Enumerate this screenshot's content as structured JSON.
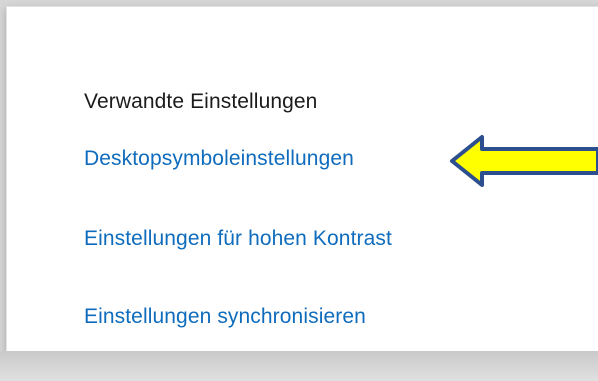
{
  "related_settings": {
    "title": "Verwandte Einstellungen",
    "links": [
      "Desktopsymboleinstellungen",
      "Einstellungen für hohen Kontrast",
      "Einstellungen synchronisieren"
    ]
  },
  "annotation": {
    "icon": "arrow-left-icon",
    "fill_color": "#ffff00",
    "outline_color": "#2e4f8f"
  }
}
